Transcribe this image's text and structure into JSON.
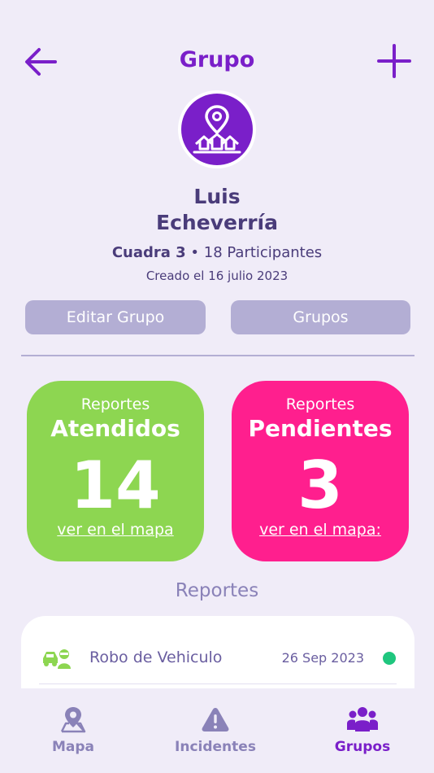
{
  "header": {
    "title": "Grupo",
    "back_icon": "arrow-left-icon",
    "add_icon": "plus-icon",
    "accent": "#7a1fc9"
  },
  "group": {
    "avatar_icon": "neighborhood-pin-icon",
    "name_line1": "Luis",
    "name_line2": "Echeverría",
    "block": "Cuadra 3",
    "separator": " • ",
    "participants": "18 Participantes",
    "created": "Creado el 16 julio 2023"
  },
  "actions": {
    "edit_label": "Editar Grupo",
    "groups_label": "Grupos"
  },
  "stats": {
    "attended": {
      "small": "Reportes",
      "big": "Atendidos",
      "count": "14",
      "link": "ver en el mapa",
      "color": "#8dd651"
    },
    "pending": {
      "small": "Reportes",
      "big": "Pendientes",
      "count": "3",
      "link": "ver en el mapa:",
      "color": "#ff1f8e"
    }
  },
  "reports": {
    "section_title": "Reportes",
    "items": [
      {
        "icon": "car-thief-icon",
        "title": "Robo de Vehiculo",
        "date": "26 Sep 2023",
        "status_color": "#1fc67e"
      }
    ]
  },
  "nav": {
    "items": [
      {
        "label": "Mapa",
        "icon": "map-pin-icon",
        "active": false
      },
      {
        "label": "Incidentes",
        "icon": "warning-icon",
        "active": false
      },
      {
        "label": "Grupos",
        "icon": "people-icon",
        "active": true
      }
    ]
  }
}
